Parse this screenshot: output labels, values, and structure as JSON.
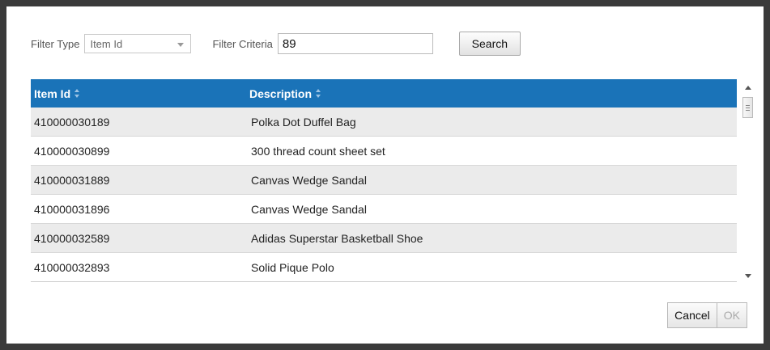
{
  "filter": {
    "type_label": "Filter Type",
    "type_value": "Item Id",
    "criteria_label": "Filter Criteria",
    "criteria_value": "89",
    "search_label": "Search"
  },
  "grid": {
    "columns": [
      "Item Id",
      "Description"
    ],
    "rows": [
      {
        "item_id": "410000030189",
        "description": "Polka Dot Duffel Bag"
      },
      {
        "item_id": "410000030899",
        "description": "300 thread count sheet set"
      },
      {
        "item_id": "410000031889",
        "description": "Canvas Wedge Sandal"
      },
      {
        "item_id": "410000031896",
        "description": "Canvas Wedge Sandal"
      },
      {
        "item_id": "410000032589",
        "description": "Adidas Superstar Basketball Shoe"
      },
      {
        "item_id": "410000032893",
        "description": "Solid Pique Polo"
      }
    ]
  },
  "footer": {
    "cancel_label": "Cancel",
    "ok_label": "OK"
  },
  "colors": {
    "header_bg": "#1a73b8",
    "frame": "#3a3a3a"
  }
}
